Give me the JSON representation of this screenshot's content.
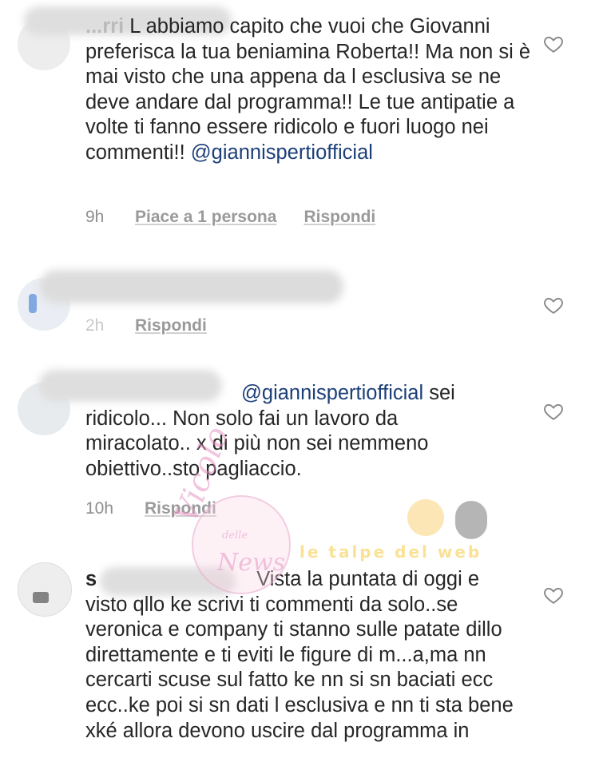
{
  "comments": [
    {
      "username_fragment": "...rri",
      "text_start": "L abbiamo capito che vuoi che Giovanni preferisca la tua beniamina Roberta!! Ma non si è mai visto che una appena da l esclusiva se ne deve andare dal programma!! Le tue antipatie a volte ti fanno essere ridicolo e fuori luogo nei commenti!! ",
      "mention": "@giannispertiofficial",
      "time": "9h",
      "likes_label": "Piace a 1 persona",
      "reply_label": "Rispondi"
    },
    {
      "time": "2h",
      "reply_label": "Rispondi"
    },
    {
      "mention": "@giannispertiofficial",
      "text_rest": "sei ridicolo... Non solo fai un lavoro da miracolato.. x di più non sei nemmeno obiettivo..sto pagliaccio.",
      "time": "10h",
      "reply_label": "Rispondi"
    },
    {
      "username_fragment": "s",
      "text_start": "Vista la puntata di oggi e visto qllo ke scrivi ti commenti da solo..se veronica e company ti stanno sulle patate dillo direttamente e ti eviti le figure di m...a,ma nn cercarti scuse sul fatto ke nn si sn baciati ecc ecc..ke poi si sn dati l esclusiva e nn ti sta bene xké allora devono uscire dal programma in"
    }
  ],
  "icons": {
    "like": "heart-outline-icon"
  },
  "watermark": {
    "script": "Vicolo",
    "small": "delle",
    "script2": "News",
    "banner": "le talpe del web"
  }
}
